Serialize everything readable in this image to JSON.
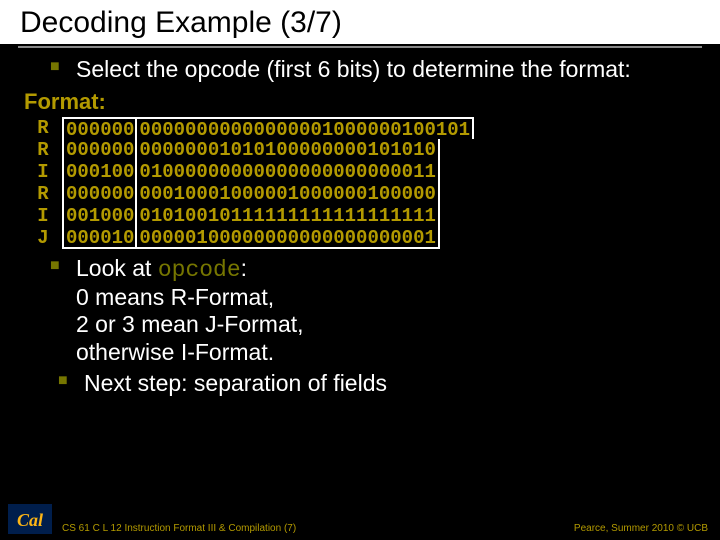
{
  "title": "Decoding Example (3/7)",
  "bullet1": "Select the opcode (first 6 bits) to determine the format:",
  "format_label": "Format:",
  "rows": [
    {
      "fmt": "R",
      "op": "000000",
      "rest": "00000000000000001000000100101"
    },
    {
      "fmt": "R",
      "op": "000000",
      "rest": "00000001010100000000101010"
    },
    {
      "fmt": "I",
      "op": "000100",
      "rest": "01000000000000000000000011"
    },
    {
      "fmt": "R",
      "op": "000000",
      "rest": "00010001000001000000100000"
    },
    {
      "fmt": "I",
      "op": "001000",
      "rest": "01010010111111111111111111"
    },
    {
      "fmt": "J",
      "op": "000010",
      "rest": "00000100000000000000000001"
    }
  ],
  "bullet2_prefix": "Look at ",
  "bullet2_code": "opcode",
  "bullet2_suffix": ":",
  "bullet2_line2": "0 means R-Format,",
  "bullet2_line3": "2 or 3 mean J-Format,",
  "bullet2_line4": "otherwise I-Format.",
  "bullet3": " Next step: separation of fields",
  "footer_left": "CS 61 C L 12 Instruction Format III & Compilation (7)",
  "footer_right": "Pearce, Summer 2010 © UCB"
}
